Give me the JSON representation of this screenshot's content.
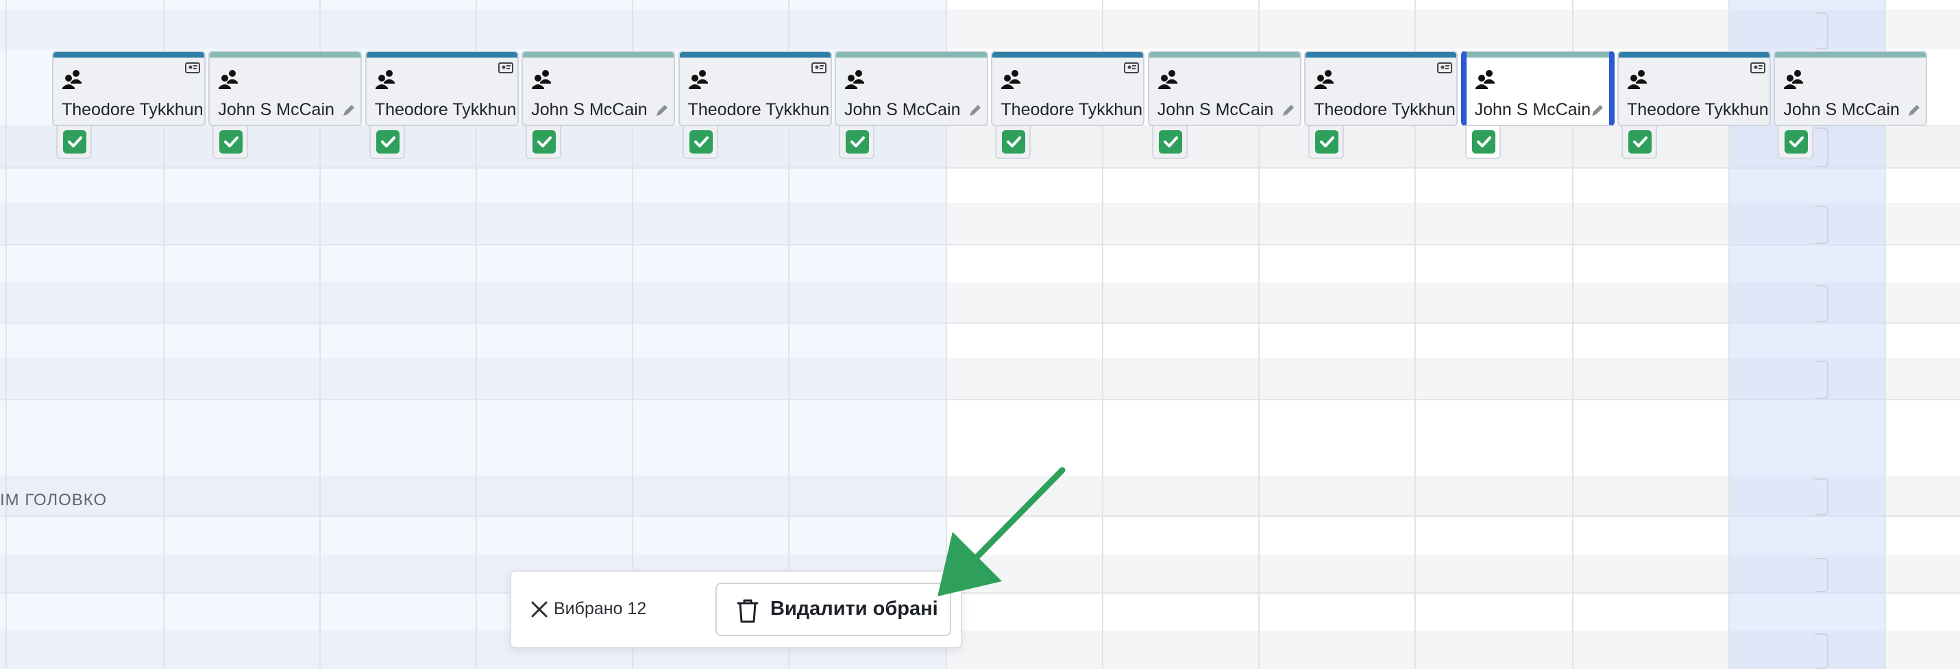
{
  "colors": {
    "accent_dark": "#2f7ea8",
    "accent_teal": "#86b9b6",
    "selection": "#2b59d1",
    "check": "#2ea05b",
    "arrow": "#2ea05b"
  },
  "timeline": {
    "cards": [
      {
        "name": "Theodore Tykkhun",
        "variant": "dark",
        "corner_icon": "id-card-icon"
      },
      {
        "name": "John S McCain",
        "variant": "teal",
        "corner_icon": "pencil-icon"
      },
      {
        "name": "Theodore Tykkhun",
        "variant": "dark",
        "corner_icon": "id-card-icon"
      },
      {
        "name": "John S McCain",
        "variant": "teal",
        "corner_icon": "pencil-icon"
      },
      {
        "name": "Theodore Tykkhun",
        "variant": "dark",
        "corner_icon": "id-card-icon"
      },
      {
        "name": "John S McCain",
        "variant": "teal",
        "corner_icon": "pencil-icon"
      },
      {
        "name": "Theodore Tykkhun",
        "variant": "dark",
        "corner_icon": "id-card-icon"
      },
      {
        "name": "John S McCain",
        "variant": "teal",
        "corner_icon": "pencil-icon"
      },
      {
        "name": "Theodore Tykkhun",
        "variant": "dark",
        "corner_icon": "id-card-icon"
      },
      {
        "name": "John S McCain",
        "variant": "teal",
        "corner_icon": "pencil-icon",
        "selected": true
      },
      {
        "name": "Theodore Tykkhun",
        "variant": "dark",
        "corner_icon": "id-card-icon"
      },
      {
        "name": "John S McCain",
        "variant": "teal",
        "corner_icon": "pencil-icon"
      }
    ],
    "group_label": "ІМ ГОЛОВКО"
  },
  "selection_bar": {
    "count_label": "Вибрано 12",
    "delete_label": "Видалити обрані"
  }
}
